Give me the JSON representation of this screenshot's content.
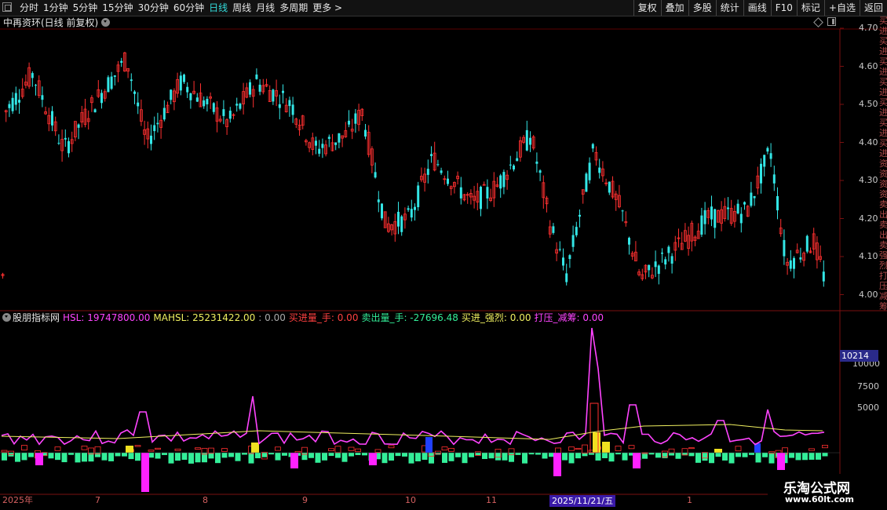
{
  "toolbar": {
    "periods": [
      {
        "label": "分时",
        "active": false
      },
      {
        "label": "1分钟",
        "active": false
      },
      {
        "label": "5分钟",
        "active": false
      },
      {
        "label": "15分钟",
        "active": false
      },
      {
        "label": "30分钟",
        "active": false
      },
      {
        "label": "60分钟",
        "active": false
      },
      {
        "label": "日线",
        "active": true
      },
      {
        "label": "周线",
        "active": false
      },
      {
        "label": "月线",
        "active": false
      },
      {
        "label": "多周期",
        "active": false
      },
      {
        "label": "更多 >",
        "active": false
      }
    ],
    "actions": [
      "复权",
      "叠加",
      "多股",
      "统计",
      "画线",
      "F10",
      "标记",
      "+自选",
      "返回"
    ]
  },
  "main_chart": {
    "title": "中再资环(日线 前复权)",
    "price_ticks": [
      "4.70",
      "4.60",
      "4.50",
      "4.40",
      "4.30",
      "4.20",
      "4.10",
      "4.00"
    ],
    "colors": {
      "up": "#ff3030",
      "down": "#33e6e6",
      "bg": "#000000"
    }
  },
  "indicator": {
    "name": "股朋指标网",
    "items": [
      {
        "text": "HSL: 19747800.00",
        "color": "#ff44ff"
      },
      {
        "text": "MAHSL: 25231422.00",
        "color": "#f0f060"
      },
      {
        "text": ": 0.00",
        "color": "#aaaaaa"
      },
      {
        "text": "买进量_手: 0.00",
        "color": "#ff4040"
      },
      {
        "text": "卖出量_手: -27696.48",
        "color": "#33ee99"
      },
      {
        "text": "买进_强烈: 0.00",
        "color": "#f0f060"
      },
      {
        "text": "打压_减筹: 0.00",
        "color": "#ff44ff"
      }
    ],
    "ticks": [
      "10000",
      "7500",
      "5000"
    ],
    "current_value": "10214"
  },
  "date_axis": {
    "labels": [
      "2025年",
      "7",
      "8",
      "9",
      "10",
      "11",
      "1"
    ],
    "selected": "2025/11/21/五"
  },
  "sidebar_text": "买进买进买进买进买进买进买进资资资资卖出卖出卖强烈打压减筹",
  "watermark": {
    "title": "乐淘公式网",
    "url": "www.60lt.com"
  }
}
